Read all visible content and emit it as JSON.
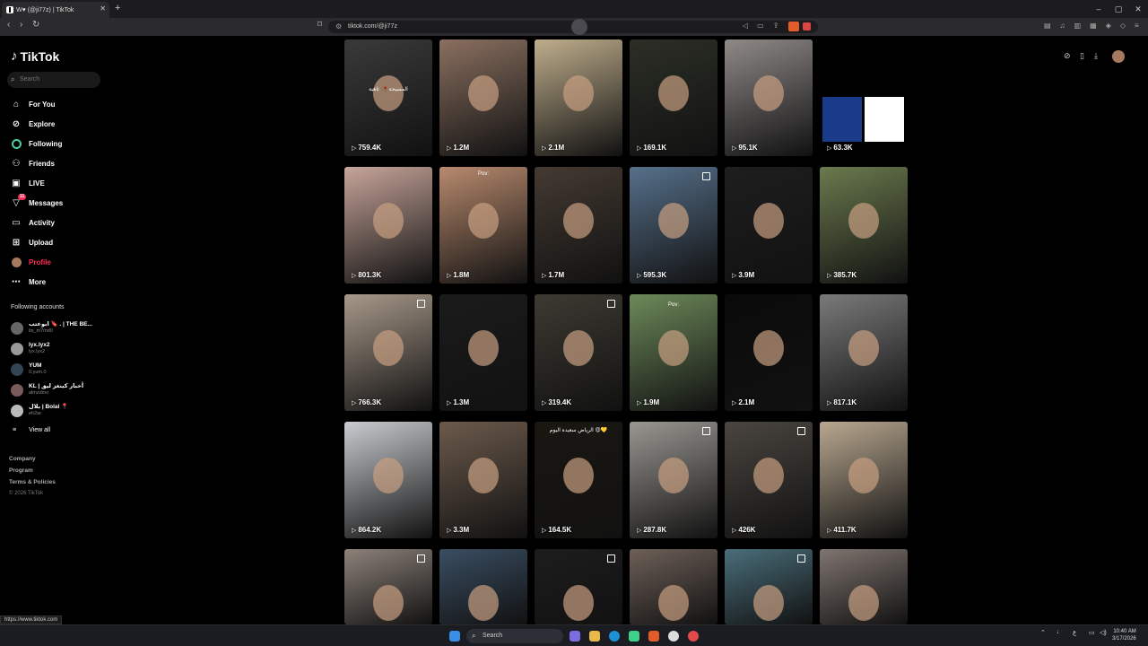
{
  "browser": {
    "tab_title": "W♥ (@ji77z) | TikTok",
    "url": "tiktok.com/@ji77z",
    "status_url": "https://www.tiktok.com"
  },
  "sidebar": {
    "logo": "TikTok",
    "search_placeholder": "Search",
    "items": [
      {
        "label": "For You",
        "icon": "home-icon"
      },
      {
        "label": "Explore",
        "icon": "compass-icon"
      },
      {
        "label": "Following",
        "icon": "following-icon"
      },
      {
        "label": "Friends",
        "icon": "friends-icon"
      },
      {
        "label": "LIVE",
        "icon": "live-icon"
      },
      {
        "label": "Messages",
        "icon": "messages-icon",
        "badge": "11"
      },
      {
        "label": "Activity",
        "icon": "activity-icon"
      },
      {
        "label": "Upload",
        "icon": "upload-icon"
      },
      {
        "label": "Profile",
        "icon": "avatar",
        "active": true
      },
      {
        "label": "More",
        "icon": "more-icon"
      }
    ],
    "following_title": "Following accounts",
    "accounts": [
      {
        "name": "ابوعتب 🔖 . | THE BE...",
        "handle": "its_m7md0"
      },
      {
        "name": "lyx.lyx2",
        "handle": "lyx.lyx2"
      },
      {
        "name": "YUM",
        "handle": "0.yum.0"
      },
      {
        "name": "KL | أخبار كينغز ليق",
        "handle": "almzdmo"
      },
      {
        "name": "بلال | Bolal 📍",
        "handle": "eh2ar"
      }
    ],
    "view_all": "View all",
    "footer": [
      "Company",
      "Program",
      "Terms & Policies"
    ],
    "copyright": "© 2026 TikTok"
  },
  "grid": {
    "rows": [
      [
        {
          "views": "759.4K",
          "caption": "المسيحة 🥀 تاهية",
          "bg": "#3a3a3a"
        },
        {
          "views": "1.2M",
          "caption": "",
          "bg": "#8a7060"
        },
        {
          "views": "2.1M",
          "caption": "",
          "bg": "#bfae8c"
        },
        {
          "views": "169.1K",
          "caption": "",
          "bg": "#2c2f26"
        },
        {
          "views": "95.1K",
          "caption": "",
          "bg": "#8f8a88"
        },
        {
          "views": "63.3K",
          "caption": "",
          "bg": "#000000"
        }
      ],
      [
        {
          "views": "801.3K",
          "caption": "",
          "bg": "#c7a59a"
        },
        {
          "views": "1.8M",
          "caption": "Pov:",
          "bg": "#b88a6e"
        },
        {
          "views": "1.7M",
          "caption": "",
          "bg": "#443a32"
        },
        {
          "views": "595.3K",
          "caption": "",
          "bg": "#56708a"
        },
        {
          "views": "3.9M",
          "caption": "",
          "bg": "#1e1e1e"
        },
        {
          "views": "385.7K",
          "caption": "",
          "bg": "#6b7a4e"
        }
      ],
      [
        {
          "views": "766.3K",
          "caption": "",
          "bg": "#a8998a"
        },
        {
          "views": "1.3M",
          "caption": "",
          "bg": "#1b1b1b"
        },
        {
          "views": "319.4K",
          "caption": "",
          "bg": "#3d3a32"
        },
        {
          "views": "1.9M",
          "caption": "Pov:",
          "bg": "#6d8a5a"
        },
        {
          "views": "2.1M",
          "caption": "",
          "bg": "#0a0a0a"
        },
        {
          "views": "817.1K",
          "caption": "",
          "bg": "#7a7a7a"
        }
      ],
      [
        {
          "views": "864.2K",
          "caption": "",
          "bg": "#c9ccd0"
        },
        {
          "views": "3.3M",
          "caption": "",
          "bg": "#6c5a4c"
        },
        {
          "views": "164.5K",
          "caption": "الرياض سعيده اليوم 😍💛",
          "bg": "#1a1712"
        },
        {
          "views": "287.8K",
          "caption": "",
          "bg": "#9a9792"
        },
        {
          "views": "426K",
          "caption": "",
          "bg": "#4a4540"
        },
        {
          "views": "411.7K",
          "caption": "",
          "bg": "#b9a890"
        }
      ],
      [
        {
          "views": "",
          "caption": "",
          "bg": "#8d827a"
        },
        {
          "views": "",
          "caption": "",
          "bg": "#3a4e62"
        },
        {
          "views": "",
          "caption": "",
          "bg": "#1d1d1d"
        },
        {
          "views": "",
          "caption": "",
          "bg": "#6e6058"
        },
        {
          "views": "",
          "caption": "",
          "bg": "#4a6e7a"
        },
        {
          "views": "",
          "caption": "",
          "bg": "#807570"
        }
      ]
    ]
  },
  "taskbar": {
    "search": "Search",
    "time": "10:40 AM",
    "date": "3/17/2026"
  }
}
